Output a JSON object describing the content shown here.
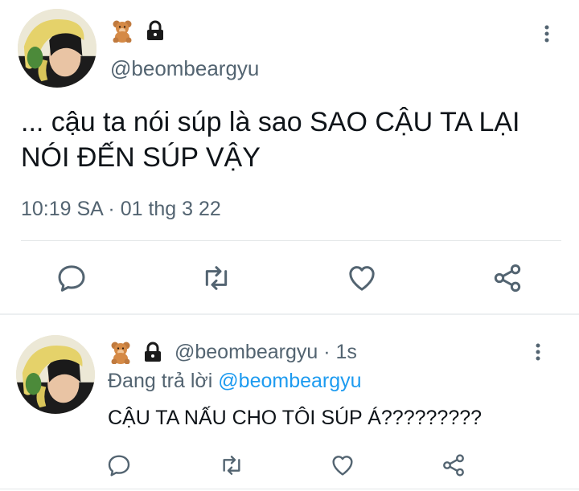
{
  "main_tweet": {
    "handle": "@beombeargyu",
    "text": "... cậu ta nói súp là sao SAO CẬU TA LẠI NÓI ĐẾN SÚP VẬY",
    "timestamp": "10:19 SA · 01 thg 3 22",
    "icons": [
      "teddy-bear-emoji",
      "lock-emoji",
      "more-options-icon"
    ]
  },
  "actions": [
    "reply-icon",
    "retweet-icon",
    "like-icon",
    "share-icon"
  ],
  "reply_tweet": {
    "handle": "@beombeargyu",
    "separator": " · ",
    "time": "1s",
    "replying_prefix": "Đang trả lời ",
    "replying_to": "@beombeargyu",
    "text": "CẬU TA NẤU CHO TÔI SÚP Á?????????"
  },
  "colors": {
    "text": "#0f1419",
    "secondary": "#536471",
    "link": "#1d9bf0",
    "icon": "#536471"
  }
}
